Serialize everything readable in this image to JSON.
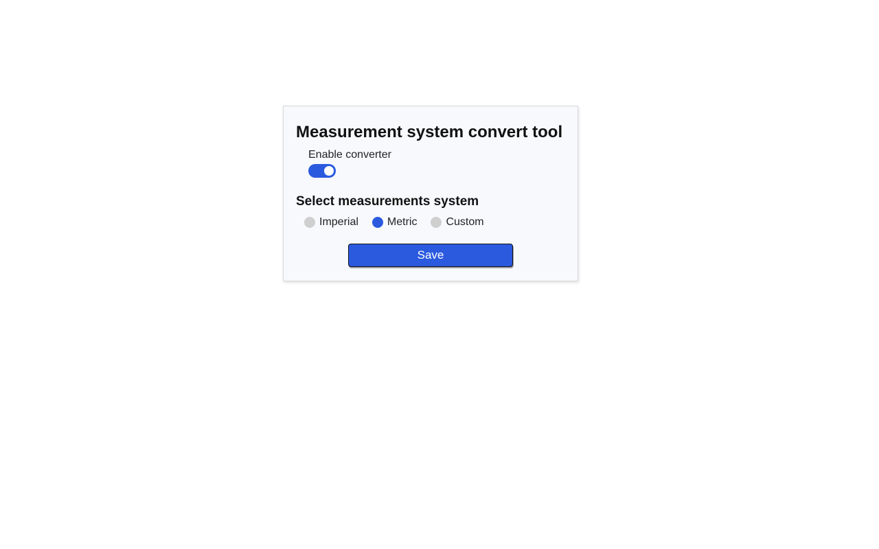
{
  "panel": {
    "title": "Measurement system convert tool",
    "enable": {
      "label": "Enable converter",
      "on": true
    },
    "systemSection": {
      "heading": "Select measurements system",
      "options": [
        {
          "label": "Imperial",
          "selected": false
        },
        {
          "label": "Metric",
          "selected": true
        },
        {
          "label": "Custom",
          "selected": false
        }
      ]
    },
    "saveLabel": "Save"
  },
  "colors": {
    "accent": "#2b5adf",
    "panelBg": "#f7f9fd"
  }
}
